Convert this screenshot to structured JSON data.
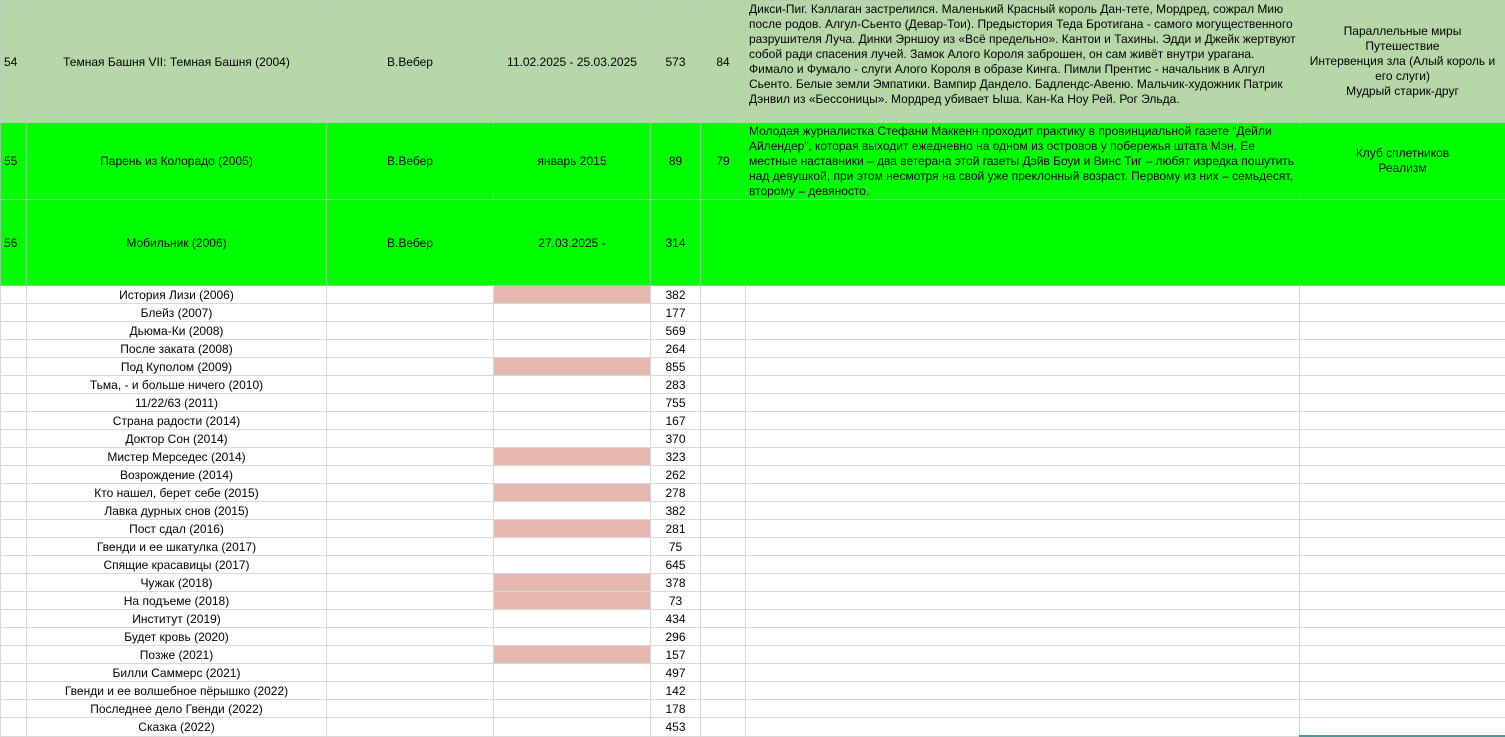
{
  "main_rows": [
    {
      "num": "54",
      "title": "Темная Башня VII: Темная Башня (2004)",
      "translator": "В.Вебер",
      "dates": "11.02.2025 - 25.03.2025",
      "pages": "573",
      "score": "84",
      "description": "Дикси-Пиг. Кэллаган застрелился. Маленький Красный король Дан-тете, Мордред, сожрал Мию после родов. Алгул-Сьенто (Девар-Тои). Предыстория Теда Бротигана - самого могущественного разрушителя Луча. Динки Эрншоу из «Всё предельно». Кантои и Тахины. Эдди и Джейк жертвуют собой ради спасения лучей. Замок Алого Короля заброшен, он сам живёт внутри урагана. Фимало и Фумало - слуги Алого Короля в образе Кинга. Пимли Прентис - начальник в Алгул Сьенто. Белые земли Эмпатики. Вампир Дандело. Бадлендс-Авеню. Мальчик-художник Патрик Дэнвил из «Бессоницы». Мордред убивает Ыша. Кан-Ка Ноу Рей. Рог Эльда.",
      "tags": [
        "Параллельные миры",
        "Путешествие",
        "Интервенция зла (Алый король и его слуги)",
        "Мудрый старик-друг"
      ]
    },
    {
      "num": "55",
      "title": "Парень из Колорадо (2005)",
      "translator": "В.Вебер",
      "dates": "январь 2015",
      "pages": "89",
      "score": "79",
      "description": "Молодая журналистка Стефани Маккенн проходит практику в провинциальной газете “Дейли Айлендер”, которая выходит ежедневно на одном из островов у побережья штата Мэн. Ее местные наставники – два ветерана этой газеты Дэйв Боуи и Винс Тиг – любят изредка пошутить над девушкой, при этом несмотря на свой уже преклонный возраст. Первому из них – семьдесят, второму – девяносто.",
      "tags": [
        "Клуб сплетников",
        "Реализм"
      ]
    },
    {
      "num": "56",
      "title": "Мобильник (2006)",
      "translator": "В.Вебер",
      "dates": "27.03.2025 -",
      "pages": "314",
      "score": "",
      "description": "",
      "tags": []
    }
  ],
  "book_rows": [
    {
      "title": "История Лизи (2006)",
      "pages": "382",
      "highlight": true
    },
    {
      "title": "Блейз (2007)",
      "pages": "177",
      "highlight": false
    },
    {
      "title": "Дьюма-Ки (2008)",
      "pages": "569",
      "highlight": false
    },
    {
      "title": "После заката (2008)",
      "pages": "264",
      "highlight": false
    },
    {
      "title": "Под Куполом (2009)",
      "pages": "855",
      "highlight": true
    },
    {
      "title": "Тьма, - и больше ничего (2010)",
      "pages": "283",
      "highlight": false
    },
    {
      "title": "11/22/63 (2011)",
      "pages": "755",
      "highlight": false
    },
    {
      "title": "Страна радости (2014)",
      "pages": "167",
      "highlight": false
    },
    {
      "title": "Доктор Сон (2014)",
      "pages": "370",
      "highlight": false
    },
    {
      "title": "Мистер Мерседес (2014)",
      "pages": "323",
      "highlight": true
    },
    {
      "title": "Возрождение (2014)",
      "pages": "262",
      "highlight": false
    },
    {
      "title": "Кто нашел, берет себе (2015)",
      "pages": "278",
      "highlight": true
    },
    {
      "title": "Лавка дурных снов (2015)",
      "pages": "382",
      "highlight": false
    },
    {
      "title": "Пост сдал (2016)",
      "pages": "281",
      "highlight": true
    },
    {
      "title": "Гвенди и ее шкатулка (2017)",
      "pages": "75",
      "highlight": false
    },
    {
      "title": "Спящие красавицы (2017)",
      "pages": "645",
      "highlight": false
    },
    {
      "title": "Чужак (2018)",
      "pages": "378",
      "highlight": true
    },
    {
      "title": "На подъеме (2018)",
      "pages": "73",
      "highlight": true
    },
    {
      "title": "Институт (2019)",
      "pages": "434",
      "highlight": false
    },
    {
      "title": "Будет кровь (2020)",
      "pages": "296",
      "highlight": false
    },
    {
      "title": "Позже (2021)",
      "pages": "157",
      "highlight": true
    },
    {
      "title": "Билли Саммерс (2021)",
      "pages": "497",
      "highlight": false
    },
    {
      "title": "Гвенди и ее волшебное пёрышко (2022)",
      "pages": "142",
      "highlight": false
    },
    {
      "title": "Последнее дело Гвенди (2022)",
      "pages": "178",
      "highlight": false
    },
    {
      "title": "Сказка (2022)",
      "pages": "453",
      "highlight": false
    }
  ],
  "colors": {
    "row_sage": "#b6d7a8",
    "row_bright_green": "#00ff00",
    "cell_pink": "#e6b8af",
    "grid": "#d9d9d9"
  }
}
